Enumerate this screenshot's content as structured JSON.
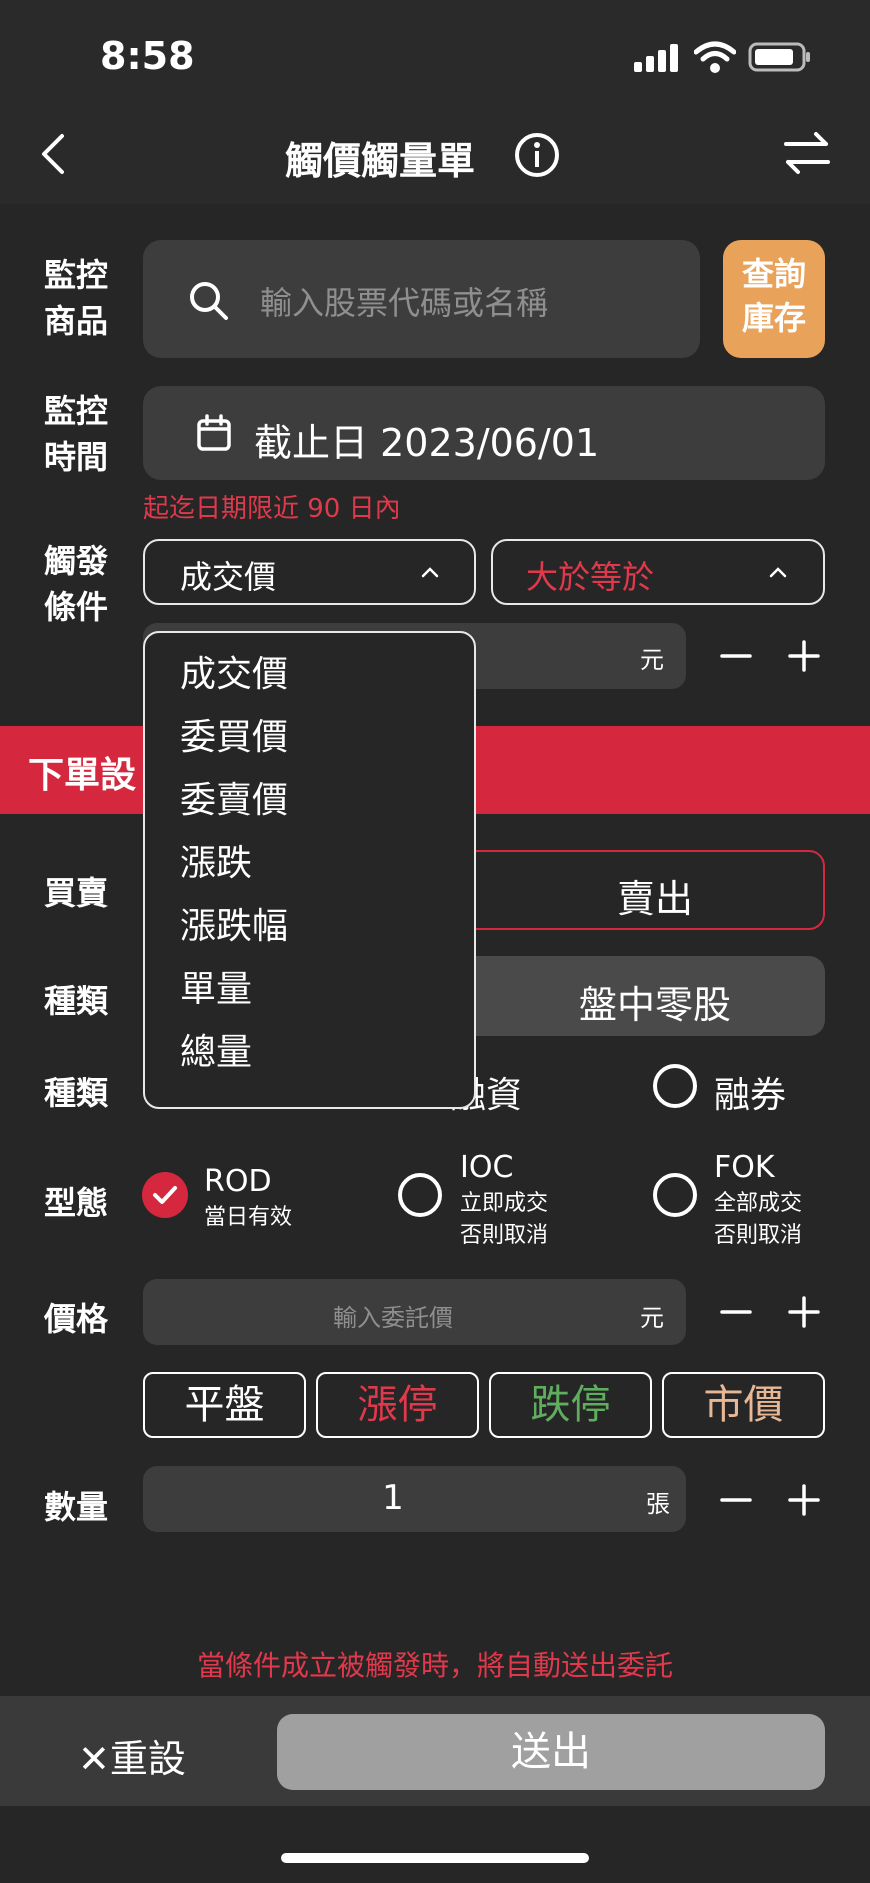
{
  "status_bar": {
    "time": "8:58"
  },
  "header": {
    "title": "觸價觸量單"
  },
  "monitor_product": {
    "label_line1": "監控",
    "label_line2": "商品",
    "search_placeholder": "輸入股票代碼或名稱",
    "inventory_button_line1": "查詢",
    "inventory_button_line2": "庫存"
  },
  "monitor_time": {
    "label_line1": "監控",
    "label_line2": "時間",
    "deadline_prefix": "截止日",
    "deadline_date": "2023/06/01",
    "hint": "起迄日期限近 90 日內"
  },
  "trigger": {
    "label_line1": "觸發",
    "label_line2": "條件",
    "field_value": "成交價",
    "operator_value": "大於等於",
    "value_unit": "元",
    "dropdown_options": [
      "成交價",
      "委買價",
      "委賣價",
      "漲跌",
      "漲跌幅",
      "單量",
      "總量"
    ]
  },
  "order_section": {
    "banner": "下單設",
    "side": {
      "label": "買賣",
      "sell": "賣出"
    },
    "type1": {
      "label": "種類",
      "odd_lot": "盤中零股"
    },
    "type2": {
      "label": "種類",
      "margin_partial": "融資",
      "short": "融券"
    },
    "form": {
      "label": "型態",
      "options": [
        {
          "code": "ROD",
          "desc1": "當日有效",
          "desc2": "",
          "selected": true
        },
        {
          "code": "IOC",
          "desc1": "立即成交",
          "desc2": "否則取消",
          "selected": false
        },
        {
          "code": "FOK",
          "desc1": "全部成交",
          "desc2": "否則取消",
          "selected": false
        }
      ]
    },
    "price": {
      "label": "價格",
      "placeholder": "輸入委託價",
      "unit": "元",
      "quick_buttons": [
        {
          "label": "平盤",
          "color": "#ffffff"
        },
        {
          "label": "漲停",
          "color": "#e0394c"
        },
        {
          "label": "跌停",
          "color": "#5fae5f"
        },
        {
          "label": "市價",
          "color": "#e8b896"
        }
      ]
    },
    "quantity": {
      "label": "數量",
      "value": "1",
      "unit": "張"
    }
  },
  "footer": {
    "notice": "當條件成立被觸發時，將自動送出委託",
    "reset": "✕重設",
    "submit": "送出"
  },
  "colors": {
    "accent_red": "#d5283e",
    "orange": "#e8a25a",
    "background": "#262626",
    "field": "#3d3d3d"
  }
}
